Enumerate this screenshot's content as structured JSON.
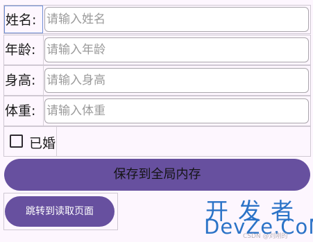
{
  "form": {
    "name": {
      "label": "姓名:",
      "placeholder": "请输入姓名",
      "value": ""
    },
    "age": {
      "label": "年龄:",
      "placeholder": "请输入年龄",
      "value": ""
    },
    "height": {
      "label": "身高:",
      "placeholder": "请输入身高",
      "value": ""
    },
    "weight": {
      "label": "体重:",
      "placeholder": "请输入体重",
      "value": ""
    },
    "married": {
      "label": "已婚",
      "checked": false
    }
  },
  "buttons": {
    "save_label": "保存到全局内存",
    "jump_label": "跳转到读取页面"
  },
  "watermark": {
    "cn": "开发者",
    "en": "DevZe.CoM",
    "small": "CSDN @刘刚的"
  },
  "colors": {
    "accent": "#67509f",
    "background": "#fdf6fe",
    "watermark": "#2b73c7"
  }
}
